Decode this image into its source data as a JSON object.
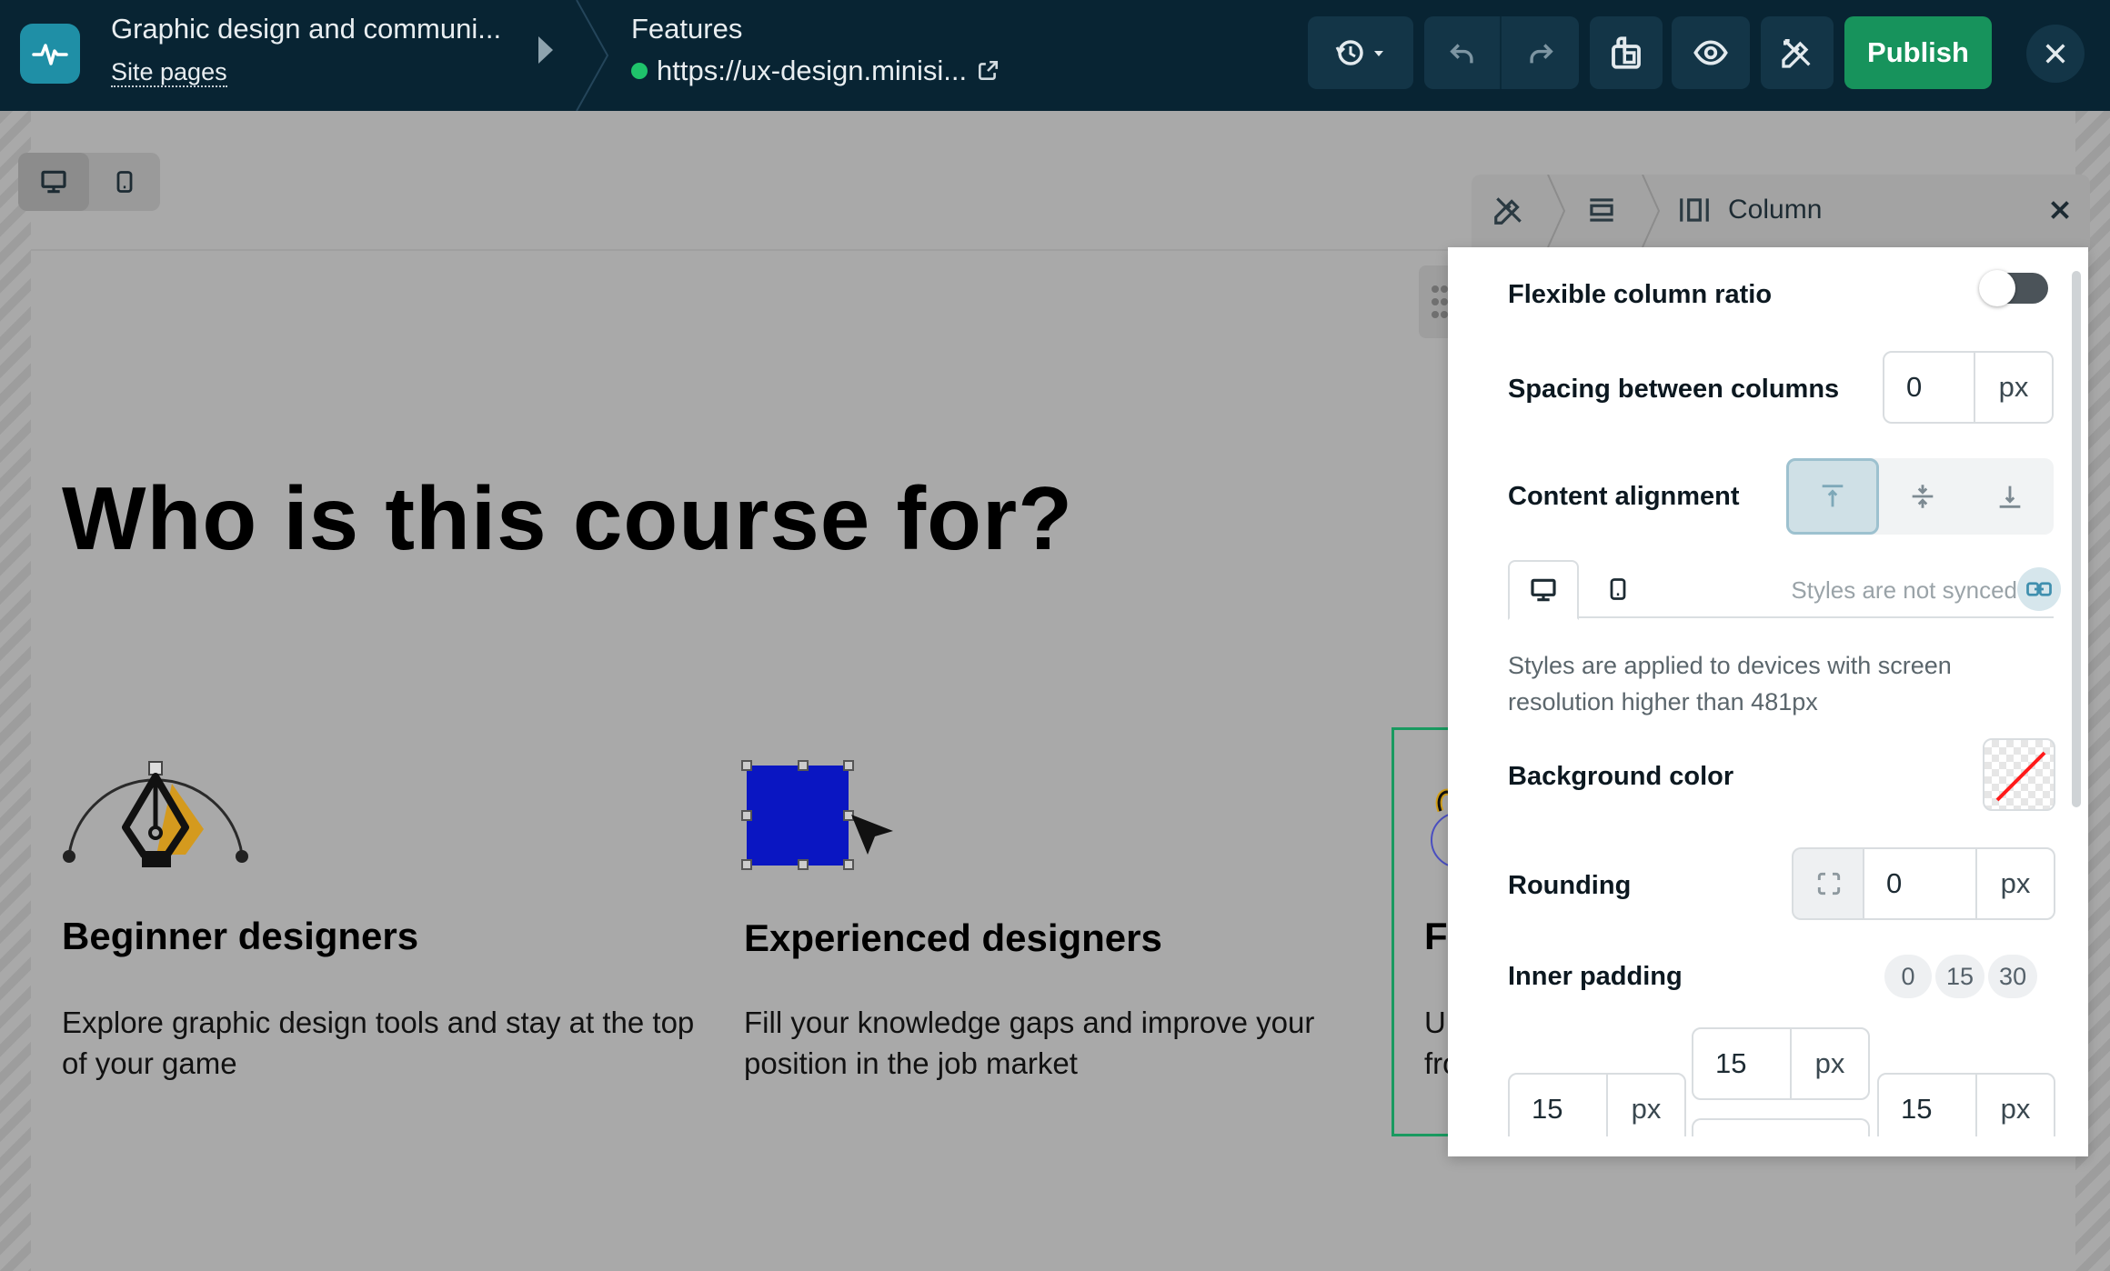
{
  "topbar": {
    "site_title": "Graphic design and communi...",
    "site_pages_link": "Site pages",
    "page_name": "Features",
    "page_url": "https://ux-design.minisi...",
    "publish_label": "Publish",
    "icons": [
      "history-icon",
      "undo-icon",
      "redo-icon",
      "pages-icon",
      "preview-icon",
      "design-tools-icon",
      "close-icon"
    ]
  },
  "canvas": {
    "heading": "Who is this course for?",
    "cards": [
      {
        "title": "Beginner designers",
        "description": "Explore graphic design tools and stay at the top of your game",
        "icon": "pen-tool-icon"
      },
      {
        "title": "Experienced designers",
        "description": "Fill your knowledge gaps and improve your position in the job market",
        "icon": "select-shape-icon"
      },
      {
        "title": "Fre",
        "description": "Up\nfror",
        "icon": "brush-icon"
      }
    ]
  },
  "panel": {
    "title": "Column",
    "flexible_ratio_label": "Flexible column ratio",
    "flexible_ratio_on": false,
    "spacing_label": "Spacing between columns",
    "spacing_value": "0",
    "spacing_unit": "px",
    "alignment_label": "Content alignment",
    "alignment_active": "top",
    "sync_text": "Styles are not synced",
    "device_hint": "Styles are applied to devices with screen resolution higher than 481px",
    "background_label": "Background color",
    "rounding_label": "Rounding",
    "rounding_value": "0",
    "rounding_unit": "px",
    "padding_label": "Inner padding",
    "padding_presets": [
      "0",
      "15",
      "30"
    ],
    "padding_top": "15",
    "padding_left": "15",
    "padding_right": "15",
    "padding_unit": "px"
  },
  "colors": {
    "topbar_bg": "#082433",
    "publish_bg": "#17935c",
    "selection_border": "#199a60",
    "canvas_overlay": "#a9a9a9"
  }
}
